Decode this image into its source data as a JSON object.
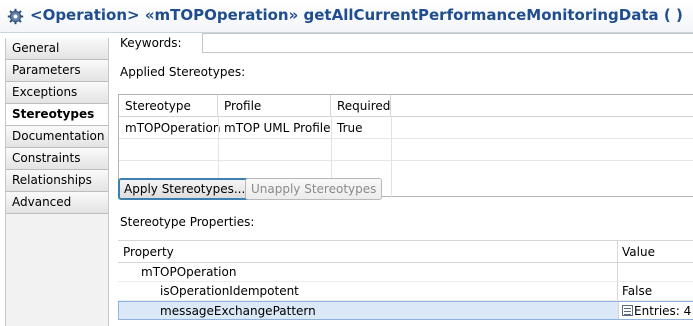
{
  "title": {
    "text": "<Operation> «mTOPOperation» getAllCurrentPerformanceMonitoringData ( )",
    "icon": "gear-icon",
    "color": "#1f4d8e"
  },
  "tabs": [
    {
      "label": "General",
      "active": false
    },
    {
      "label": "Parameters",
      "active": false
    },
    {
      "label": "Exceptions",
      "active": false
    },
    {
      "label": "Stereotypes",
      "active": true
    },
    {
      "label": "Documentation",
      "active": false
    },
    {
      "label": "Constraints",
      "active": false
    },
    {
      "label": "Relationships",
      "active": false
    },
    {
      "label": "Advanced",
      "active": false
    }
  ],
  "keywords": {
    "label": "Keywords:",
    "value": ""
  },
  "applied_stereotypes": {
    "label": "Applied Stereotypes:",
    "columns": [
      "Stereotype",
      "Profile",
      "Required"
    ],
    "rows": [
      [
        "mTOPOperation",
        "mTOP UML Profile",
        "True"
      ]
    ]
  },
  "buttons": {
    "apply": "Apply Stereotypes...",
    "unapply": "Unapply Stereotypes"
  },
  "stereotype_properties": {
    "label": "Stereotype Properties:",
    "columns": [
      "Property",
      "Value"
    ],
    "rows": [
      {
        "name": "mTOPOperation",
        "value": ""
      },
      {
        "name": "isOperationIdempotent",
        "value": "False"
      },
      {
        "name": "messageExchangePattern",
        "value": "Entries: 4",
        "icon": "list-icon"
      }
    ]
  }
}
